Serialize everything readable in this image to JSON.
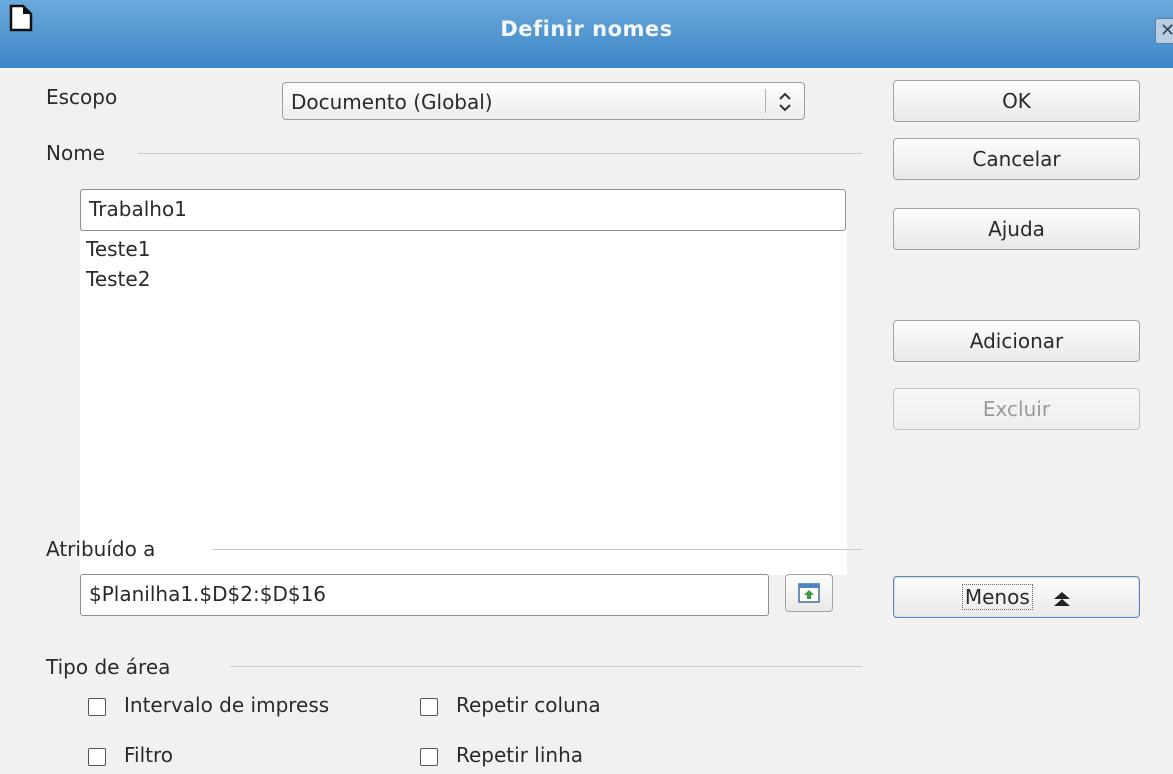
{
  "window": {
    "title": "Definir nomes",
    "close_glyph": "✕"
  },
  "scope": {
    "label": "Escopo",
    "value": "Documento (Global)"
  },
  "name_section": {
    "label": "Nome",
    "input_value": "Trabalho1",
    "list_items": [
      "Teste1",
      "Teste2"
    ]
  },
  "assigned": {
    "label": "Atribuído a",
    "value": "$Planilha1.$D$2:$D$16"
  },
  "area_type": {
    "label": "Tipo de área",
    "options": [
      {
        "label": "Intervalo de impress",
        "checked": false
      },
      {
        "label": "Repetir coluna",
        "checked": false
      },
      {
        "label": "Filtro",
        "checked": false
      },
      {
        "label": "Repetir linha",
        "checked": false
      }
    ]
  },
  "buttons": {
    "ok": "OK",
    "cancel": "Cancelar",
    "help": "Ajuda",
    "add": "Adicionar",
    "delete": "Excluir",
    "less": "Menos"
  },
  "colors": {
    "titlebar": "#4a90d2",
    "dialog_bg": "#f1f1ef"
  }
}
